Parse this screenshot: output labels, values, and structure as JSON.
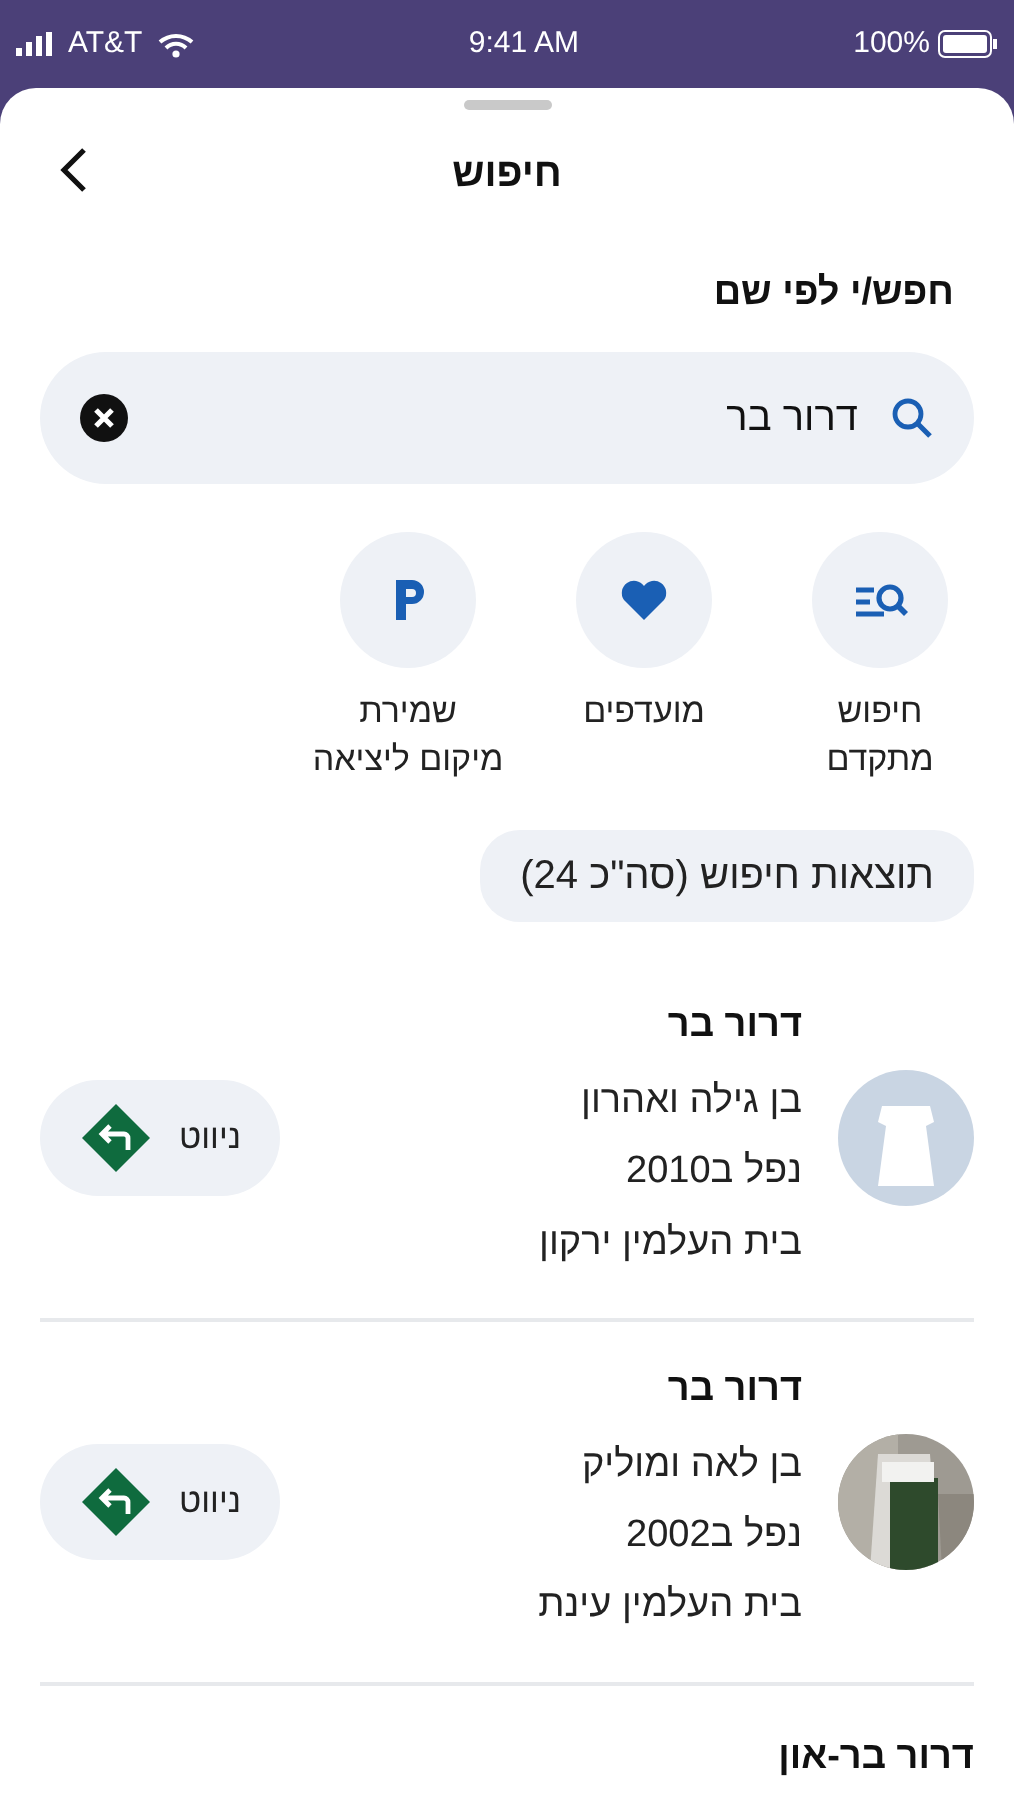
{
  "status_bar": {
    "carrier": "AT&T",
    "time": "9:41 AM",
    "battery": "100%"
  },
  "header": {
    "title": "חיפוש"
  },
  "search": {
    "label": "חפש/י לפי שם",
    "value": "דרור בר"
  },
  "actions": [
    {
      "kind": "advanced",
      "label": "חיפוש\nמתקדם"
    },
    {
      "kind": "favorites",
      "label": "מועדפים"
    },
    {
      "kind": "parking",
      "label": "שמירת\nמיקום ליציאה"
    }
  ],
  "results_label": "תוצאות חיפוש (סה\"כ 24)",
  "results": [
    {
      "name": "דרור בר",
      "parents": "בן גילה ואהרון",
      "fell": "נפל ב2010",
      "cemetery": "בית העלמין ירקון",
      "avatar": {
        "kind": "placeholder"
      },
      "navigate": "ניווט"
    },
    {
      "name": "דרור בר",
      "parents": "בן לאה ומוליק",
      "fell": "נפל ב2002",
      "cemetery": "בית העלמין עינת",
      "navigate": "ניווט"
    },
    {
      "name": "דרור בר-און"
    }
  ]
}
